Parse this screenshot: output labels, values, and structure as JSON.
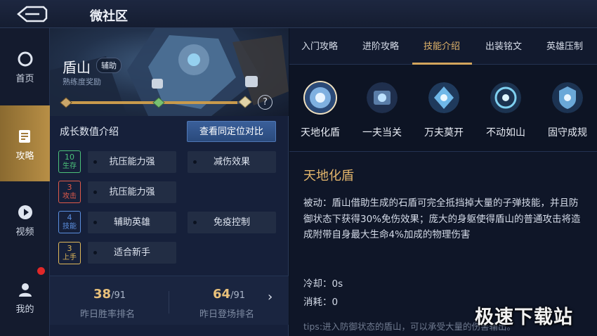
{
  "topbar": {
    "title": "微社区",
    "back_icon": "back-arrow-icon"
  },
  "leftnav": {
    "items": [
      {
        "label": "首页",
        "icon": "home-icon",
        "active": false
      },
      {
        "label": "攻略",
        "icon": "guide-icon",
        "active": true
      },
      {
        "label": "视频",
        "icon": "play-icon",
        "active": false
      },
      {
        "label": "我的",
        "icon": "user-icon",
        "active": false,
        "has_badge": true
      }
    ]
  },
  "hero": {
    "name": "盾山",
    "role": "辅助",
    "proficiency_label": "熟练度奖励",
    "proficiency_progress": 0.95,
    "help": "?"
  },
  "stats": {
    "title": "成长数值介绍",
    "compare_label": "查看同定位对比",
    "badges": [
      {
        "value": "10",
        "label": "生存",
        "color": "#4cc27a"
      },
      {
        "value": "3",
        "label": "攻击",
        "color": "#e05a4a"
      },
      {
        "value": "4",
        "label": "技能",
        "color": "#5b8fe0"
      },
      {
        "value": "3",
        "label": "上手",
        "color": "#e0b85a"
      }
    ],
    "traits": [
      "抗压能力强",
      "减伤效果",
      "抗压能力强",
      "辅助英雄",
      "免疫控制",
      "适合新手"
    ]
  },
  "ranks": {
    "win_rank": "38",
    "win_total": "/91",
    "win_label": "昨日胜率排名",
    "appear_rank": "64",
    "appear_total": "/91",
    "appear_label": "昨日登场排名",
    "chevron": "›"
  },
  "tabs": [
    "入门攻略",
    "进阶攻略",
    "技能介绍",
    "出装铭文",
    "英雄压制"
  ],
  "active_tab": 2,
  "skills": [
    {
      "name": "天地化盾",
      "icon": "shield-skill-icon",
      "active": true
    },
    {
      "name": "一夫当关",
      "icon": "guard-skill-icon",
      "active": false
    },
    {
      "name": "万夫莫开",
      "icon": "fortress-skill-icon",
      "active": false
    },
    {
      "name": "不动如山",
      "icon": "mountain-skill-icon",
      "active": false
    },
    {
      "name": "固守成规",
      "icon": "defense-skill-icon",
      "active": false
    }
  ],
  "detail": {
    "title": "天地化盾",
    "body": "被动：盾山借助生成的石盾可完全抵挡掉大量的子弹技能，并且防御状态下获得30%免伤效果；庞大的身躯使得盾山的普通攻击将造成附带自身最大生命4%加成的物理伤害",
    "cooldown": "冷却：0s",
    "cost": "消耗：0",
    "tips": "tips:进入防御状态的盾山，可以承受大量的伤害输出。"
  },
  "watermark": "极速下载站"
}
